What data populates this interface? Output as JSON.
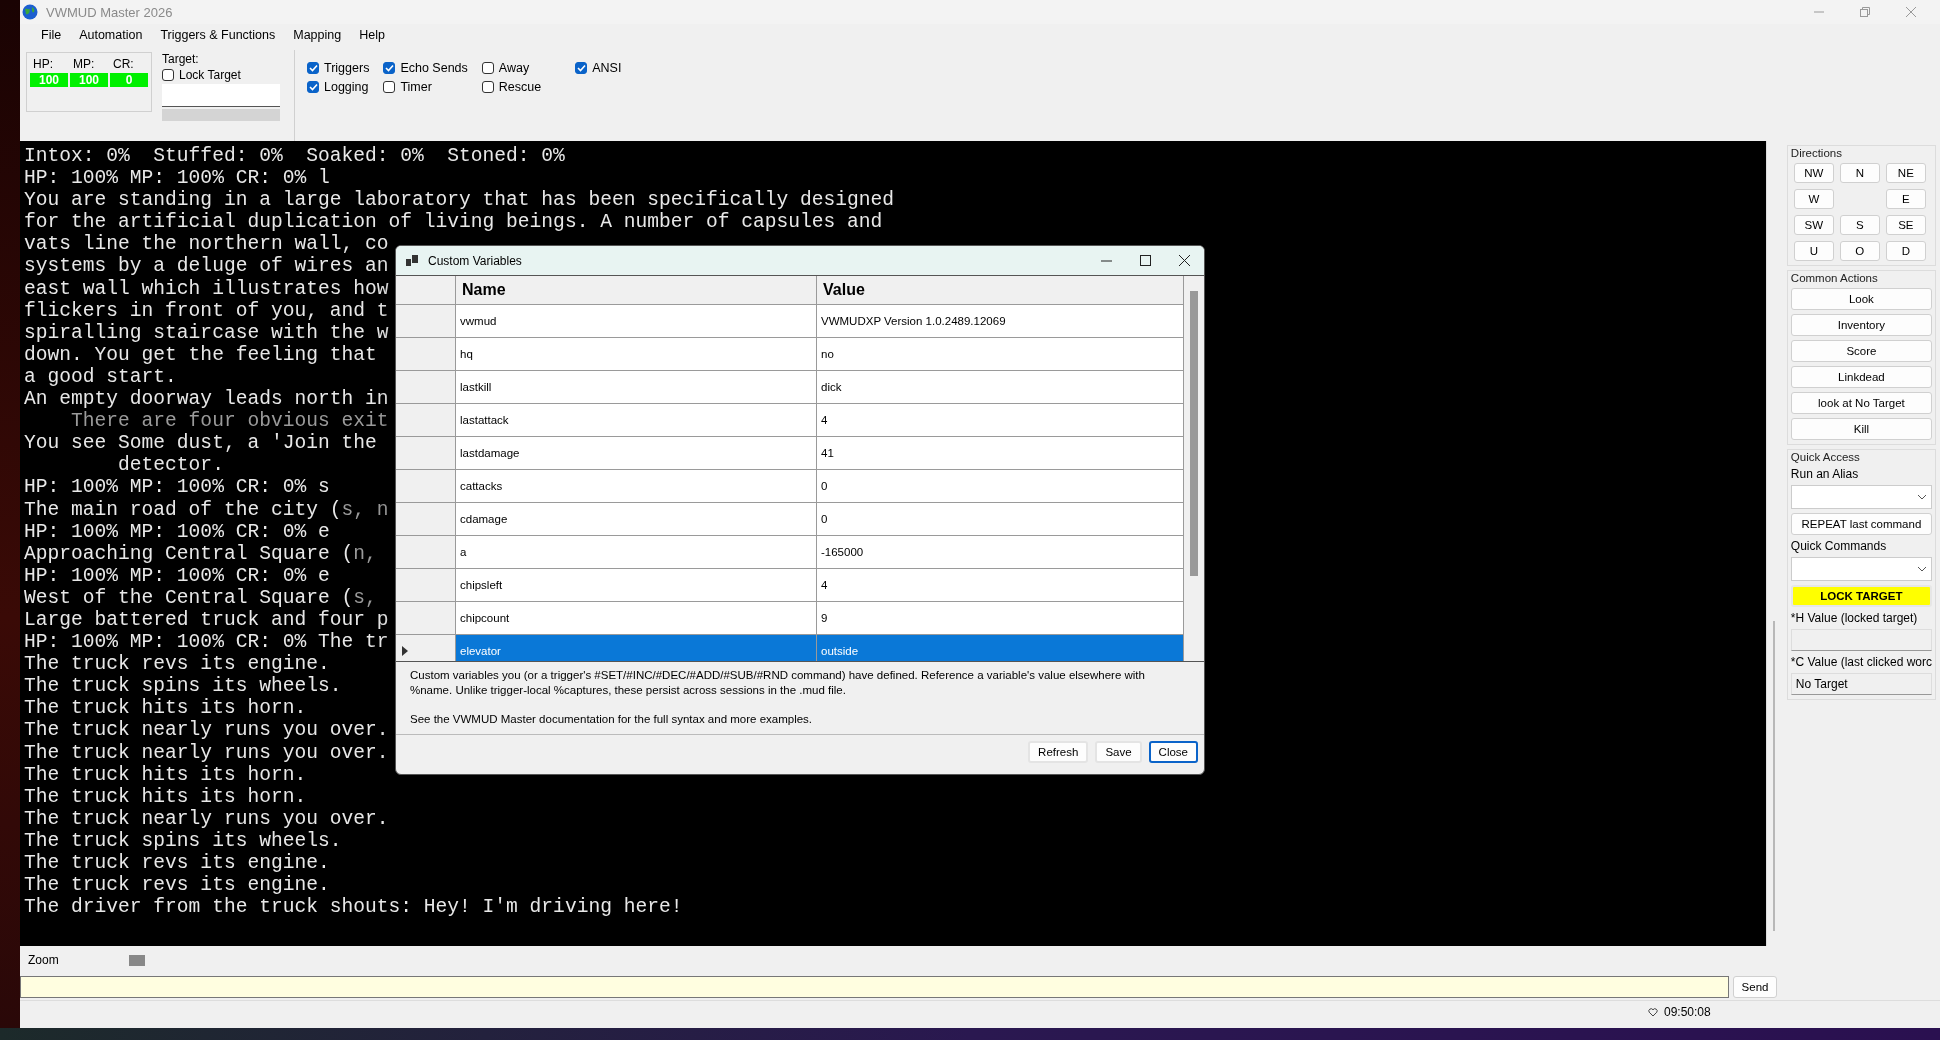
{
  "window": {
    "title": "VWMUD Master 2026"
  },
  "menu": [
    "File",
    "Automation",
    "Triggers & Functions",
    "Mapping",
    "Help"
  ],
  "stats": [
    {
      "label": "HP:",
      "value": "100"
    },
    {
      "label": "MP:",
      "value": "100"
    },
    {
      "label": "CR:",
      "value": "0"
    }
  ],
  "target": {
    "label": "Target:",
    "lock": {
      "label": "Lock Target",
      "checked": false
    }
  },
  "options": [
    {
      "label": "Triggers",
      "checked": true
    },
    {
      "label": "Logging",
      "checked": true
    },
    {
      "label": "Echo Sends",
      "checked": true
    },
    {
      "label": "Timer",
      "checked": false
    },
    {
      "label": "Away",
      "checked": false
    },
    {
      "label": "Rescue",
      "checked": false
    },
    {
      "label": "ANSI",
      "checked": true
    }
  ],
  "terminal": {
    "lines": [
      {
        "parts": [
          {
            "text": "Intox: 0%  Stuffed: 0%  Soaked: 0%  Stoned: 0%",
            "dim": false
          }
        ]
      },
      {
        "parts": [
          {
            "text": "HP: 100% MP: 100% CR: 0% l",
            "dim": false
          }
        ]
      },
      {
        "parts": [
          {
            "text": "You are standing in a large laboratory that has been specifically designed",
            "dim": false
          }
        ]
      },
      {
        "parts": [
          {
            "text": "for the artificial duplication of living beings. A number of capsules and",
            "dim": false
          }
        ]
      },
      {
        "parts": [
          {
            "text": "vats line the northern wall, co",
            "dim": false
          }
        ]
      },
      {
        "parts": [
          {
            "text": "systems by a deluge of wires an",
            "dim": false
          }
        ]
      },
      {
        "parts": [
          {
            "text": "east wall which illustrates how",
            "dim": false
          }
        ]
      },
      {
        "parts": [
          {
            "text": "flickers in front of you, and t",
            "dim": false
          }
        ]
      },
      {
        "parts": [
          {
            "text": "spiralling staircase with the w",
            "dim": false
          }
        ]
      },
      {
        "parts": [
          {
            "text": "down. You get the feeling that",
            "dim": false
          }
        ]
      },
      {
        "parts": [
          {
            "text": "a good start.",
            "dim": false
          }
        ]
      },
      {
        "parts": [
          {
            "text": "An empty doorway leads north in",
            "dim": false
          }
        ]
      },
      {
        "parts": [
          {
            "text": "    There are four obvious exit",
            "dim": true
          }
        ]
      },
      {
        "parts": [
          {
            "text": "You see Some dust, a 'Join the",
            "dim": false
          }
        ]
      },
      {
        "parts": [
          {
            "text": "        detector.",
            "dim": false
          }
        ]
      },
      {
        "parts": [
          {
            "text": "HP: 100% MP: 100% CR: 0% s",
            "dim": false
          }
        ]
      },
      {
        "parts": [
          {
            "text": "The main road of the city (",
            "dim": false
          },
          {
            "text": "s, n",
            "dim": true
          }
        ]
      },
      {
        "parts": [
          {
            "text": "HP: 100% MP: 100% CR: 0% e",
            "dim": false
          }
        ]
      },
      {
        "parts": [
          {
            "text": "Approaching Central Square (",
            "dim": false
          },
          {
            "text": "n,",
            "dim": true
          }
        ]
      },
      {
        "parts": [
          {
            "text": "HP: 100% MP: 100% CR: 0% e",
            "dim": false
          }
        ]
      },
      {
        "parts": [
          {
            "text": "West of the Central Square (",
            "dim": false
          },
          {
            "text": "s,",
            "dim": true
          }
        ]
      },
      {
        "parts": [
          {
            "text": "Large battered truck and four p",
            "dim": false
          }
        ]
      },
      {
        "parts": [
          {
            "text": "HP: 100% MP: 100% CR: 0% The tr",
            "dim": false
          }
        ]
      },
      {
        "parts": [
          {
            "text": "The truck revs its engine.",
            "dim": false
          }
        ]
      },
      {
        "parts": [
          {
            "text": "The truck spins its wheels.",
            "dim": false
          }
        ]
      },
      {
        "parts": [
          {
            "text": "The truck hits its horn.",
            "dim": false
          }
        ]
      },
      {
        "parts": [
          {
            "text": "The truck nearly runs you over.",
            "dim": false
          }
        ]
      },
      {
        "parts": [
          {
            "text": "The truck nearly runs you over.",
            "dim": false
          }
        ]
      },
      {
        "parts": [
          {
            "text": "The truck hits its horn.",
            "dim": false
          }
        ]
      },
      {
        "parts": [
          {
            "text": "The truck hits its horn.",
            "dim": false
          }
        ]
      },
      {
        "parts": [
          {
            "text": "The truck nearly runs you over.",
            "dim": false
          }
        ]
      },
      {
        "parts": [
          {
            "text": "The truck spins its wheels.",
            "dim": false
          }
        ]
      },
      {
        "parts": [
          {
            "text": "The truck revs its engine.",
            "dim": false
          }
        ]
      },
      {
        "parts": [
          {
            "text": "The truck revs its engine.",
            "dim": false
          }
        ]
      },
      {
        "parts": [
          {
            "text": "The driver from the truck shouts: Hey! I'm driving here!",
            "dim": false
          }
        ]
      }
    ]
  },
  "directions": {
    "title": "Directions",
    "buttons": [
      "NW",
      "N",
      "NE",
      "W",
      "E",
      "SW",
      "S",
      "SE",
      "U",
      "O",
      "D"
    ]
  },
  "common_actions": {
    "title": "Common Actions",
    "buttons": [
      "Look",
      "Inventory",
      "Score",
      "Linkdead",
      "look at No Target",
      "Kill"
    ]
  },
  "quick_access": {
    "title": "Quick Access",
    "alias_label": "Run an Alias",
    "repeat_button": "REPEAT last command",
    "commands_label": "Quick Commands",
    "lock_button": "LOCK TARGET",
    "h_label": "*H Value (locked target)",
    "c_label": "*C Value (last clicked worc",
    "c_value": "No Target"
  },
  "zoom": {
    "label": "Zoom"
  },
  "send_button": "Send",
  "status_bar": {
    "time": "09:50:08"
  },
  "dialog": {
    "title": "Custom Variables",
    "columns": [
      "Name",
      "Value"
    ],
    "rows": [
      {
        "name": "vwmud",
        "value": "VWMUDXP Version 1.0.2489.12069",
        "selected": false
      },
      {
        "name": "hq",
        "value": "no",
        "selected": false
      },
      {
        "name": "lastkill",
        "value": "dick",
        "selected": false
      },
      {
        "name": "lastattack",
        "value": "4",
        "selected": false
      },
      {
        "name": "lastdamage",
        "value": "41",
        "selected": false
      },
      {
        "name": "cattacks",
        "value": "0",
        "selected": false
      },
      {
        "name": "cdamage",
        "value": "0",
        "selected": false
      },
      {
        "name": "a",
        "value": "-165000",
        "selected": false
      },
      {
        "name": "chipsleft",
        "value": "4",
        "selected": false
      },
      {
        "name": "chipcount",
        "value": "9",
        "selected": false
      },
      {
        "name": "elevator",
        "value": "outside",
        "selected": true
      }
    ],
    "description": [
      "Custom variables you (or a trigger's #SET/#INC/#DEC/#ADD/#SUB/#RND command) have defined. Reference a variable's value elsewhere with %name. Unlike trigger-local %captures, these persist across sessions in the .mud file.",
      "See the VWMUD Master documentation for the full syntax and more examples."
    ],
    "buttons": [
      {
        "label": "Refresh",
        "focused": false
      },
      {
        "label": "Save",
        "focused": false
      },
      {
        "label": "Close",
        "focused": true
      }
    ]
  }
}
